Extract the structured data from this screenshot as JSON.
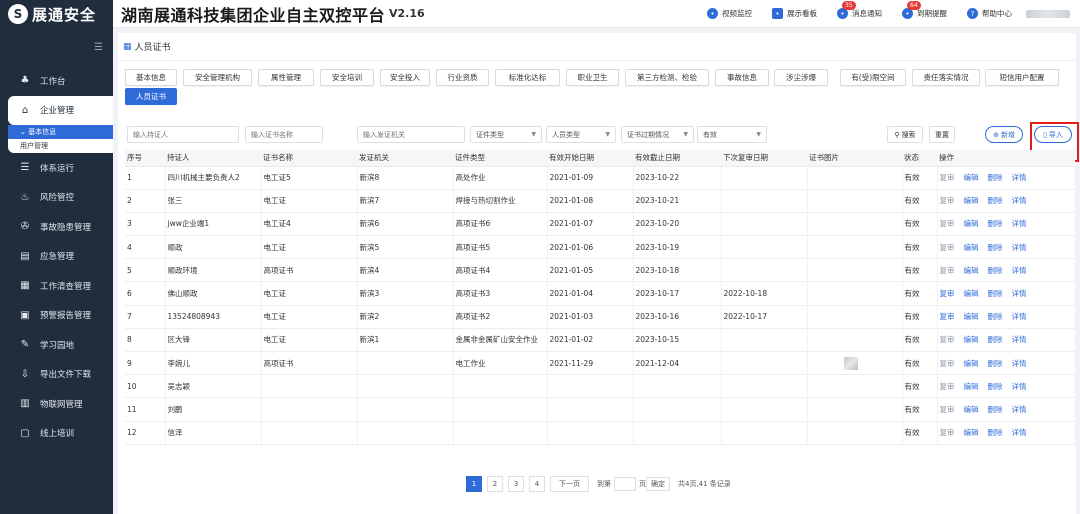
{
  "brand": {
    "logo_text": "展通安全"
  },
  "header": {
    "title": "湖南展通科技集团企业自主双控平台",
    "version": "V2.16",
    "actions": [
      {
        "label": "视频监控",
        "icon": "camera-icon",
        "badge": ""
      },
      {
        "label": "展示看板",
        "icon": "dashboard-icon",
        "badge": ""
      },
      {
        "label": "消息通知",
        "icon": "message-icon",
        "badge": "35"
      },
      {
        "label": "到期提醒",
        "icon": "clock-icon",
        "badge": "64"
      },
      {
        "label": "帮助中心",
        "icon": "help-icon",
        "badge": ""
      }
    ]
  },
  "sidebar": {
    "items": [
      {
        "label": "工作台",
        "icon": "workbench-icon",
        "glyph": "♣"
      },
      {
        "label": "企业管理",
        "icon": "home-icon",
        "glyph": "⌂",
        "active": true
      },
      {
        "label": "体系运行",
        "icon": "system-icon",
        "glyph": "☰"
      },
      {
        "label": "风险管控",
        "icon": "fire-icon",
        "glyph": "♨"
      },
      {
        "label": "事故隐患管理",
        "icon": "hazard-icon",
        "glyph": "✇"
      },
      {
        "label": "应急管理",
        "icon": "emergency-icon",
        "glyph": "▤"
      },
      {
        "label": "工作清查管理",
        "icon": "calendar-icon",
        "glyph": "▦"
      },
      {
        "label": "预警报告管理",
        "icon": "report-icon",
        "glyph": "▣"
      },
      {
        "label": "学习园地",
        "icon": "graduation-icon",
        "glyph": "✎"
      },
      {
        "label": "导出文件下载",
        "icon": "download-icon",
        "glyph": "⇩"
      },
      {
        "label": "物联网管理",
        "icon": "iot-icon",
        "glyph": "▥"
      },
      {
        "label": "线上培训",
        "icon": "training-icon",
        "glyph": "▢"
      }
    ],
    "submenu": [
      {
        "label": "基本信息",
        "active": true
      },
      {
        "label": "用户管理",
        "active": false
      }
    ]
  },
  "page": {
    "title": "人员证书"
  },
  "tabs": [
    "基本信息",
    "安全管理机构",
    "属性管理",
    "安全培训",
    "安全投入",
    "行业资质",
    "标准化达标",
    "职业卫生",
    "第三方检测、检验",
    "事故信息",
    "涉尘涉爆",
    "有(受)限空间",
    "责任落实情况",
    "短信用户配置",
    "人员证书"
  ],
  "active_tab": "人员证书",
  "filters": {
    "holder_placeholder": "输入持证人",
    "cert_name_placeholder": "输入证书名称",
    "issuer_placeholder": "输入发证机关",
    "cert_type": "证件类型",
    "person_type": "人员类型",
    "expiry_status": "证书过期情况",
    "validity": "有效",
    "search_label": "搜索",
    "reset_label": "重置",
    "add_label": "新增",
    "import_label": "导入"
  },
  "table": {
    "headers": [
      "序号",
      "持证人",
      "证书名称",
      "发证机关",
      "证件类型",
      "有效开始日期",
      "有效截止日期",
      "下次复审日期",
      "证书图片",
      "状态",
      "操作"
    ],
    "rows": [
      [
        "1",
        "四川机械主要负责人2",
        "电工证5",
        "新滨8",
        "高处作业",
        "2021-01-09",
        "2023-10-22",
        "",
        "",
        "有效"
      ],
      [
        "2",
        "张三",
        "电工证",
        "新滨7",
        "焊接与热切割作业",
        "2021-01-08",
        "2023-10-21",
        "",
        "",
        "有效"
      ],
      [
        "3",
        "jww企业端1",
        "电工证4",
        "新滨6",
        "高项证书6",
        "2021-01-07",
        "2023-10-20",
        "",
        "",
        "有效"
      ],
      [
        "4",
        "顺政",
        "电工证",
        "新滨5",
        "高项证书5",
        "2021-01-06",
        "2023-10-19",
        "",
        "",
        "有效"
      ],
      [
        "5",
        "顺政环境",
        "高项证书",
        "新滨4",
        "高项证书4",
        "2021-01-05",
        "2023-10-18",
        "",
        "",
        "有效"
      ],
      [
        "6",
        "佛山顺政",
        "电工证",
        "新滨3",
        "高项证书3",
        "2021-01-04",
        "2023-10-17",
        "2022-10-18",
        "",
        "有效"
      ],
      [
        "7",
        "13524808943",
        "电工证",
        "新滨2",
        "高项证书2",
        "2021-01-03",
        "2023-10-16",
        "2022-10-17",
        "",
        "有效"
      ],
      [
        "8",
        "区大锋",
        "电工证",
        "新滨1",
        "金属非金属矿山安全作业",
        "2021-01-02",
        "2023-10-15",
        "",
        "",
        "有效"
      ],
      [
        "9",
        "李婉儿",
        "高项证书",
        "",
        "电工作业",
        "2021-11-29",
        "2021-12-04",
        "",
        "image",
        "有效"
      ],
      [
        "10",
        "吴志颖",
        "",
        "",
        "",
        "",
        "",
        "",
        "",
        "有效"
      ],
      [
        "11",
        "刘鹏",
        "",
        "",
        "",
        "",
        "",
        "",
        "",
        "有效"
      ],
      [
        "12",
        "信泽",
        "",
        "",
        "",
        "",
        "",
        "",
        "",
        "有效"
      ]
    ],
    "row_actions": [
      "复审",
      "编辑",
      "删除",
      "详情"
    ]
  },
  "pagination": {
    "pages": [
      "1",
      "2",
      "3",
      "4"
    ],
    "current": "1",
    "next_label": "下一页",
    "goto_label": "到第",
    "page_unit": "页",
    "confirm_label": "确定",
    "summary": "共4页,41 条记录"
  },
  "colors": {
    "sidebar_bg": "#1f2d3d",
    "accent": "#2f6bd8",
    "highlight_box": "#e0201a"
  }
}
